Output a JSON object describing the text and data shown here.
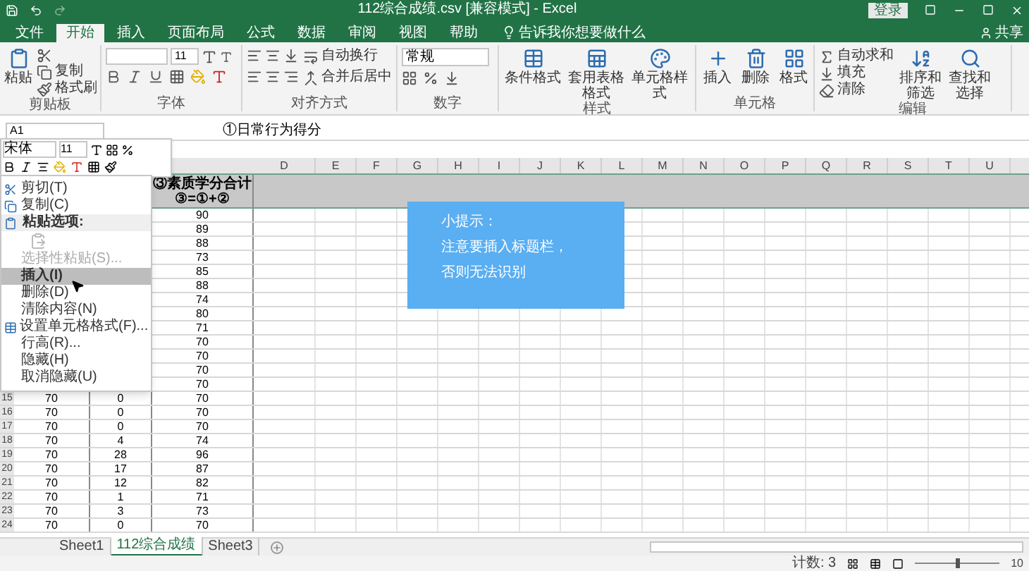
{
  "title_bar": {
    "title": "112综合成绩.csv [兼容模式] - Excel",
    "sign_in": "登录"
  },
  "tabs": [
    {
      "label": "文件",
      "selected": false
    },
    {
      "label": "开始",
      "selected": true
    },
    {
      "label": "插入",
      "selected": false
    },
    {
      "label": "页面布局",
      "selected": false
    },
    {
      "label": "公式",
      "selected": false
    },
    {
      "label": "数据",
      "selected": false
    },
    {
      "label": "审阅",
      "selected": false
    },
    {
      "label": "视图",
      "selected": false
    },
    {
      "label": "帮助",
      "selected": false
    }
  ],
  "tell_me": "告诉我你想要做什么",
  "share": "共享",
  "ribbon": {
    "clipboard": {
      "label": "剪贴板",
      "paste": "粘贴",
      "copy": "复制",
      "format_painter": "格式刷"
    },
    "font": {
      "label": "字体",
      "size": "11"
    },
    "alignment": {
      "label": "对齐方式",
      "wrap": "自动换行",
      "merge": "合并后居中"
    },
    "number": {
      "label": "数字",
      "format": "常规"
    },
    "styles": {
      "label": "样式",
      "items": [
        "条件格式",
        "套用表格格式",
        "单元格样式"
      ]
    },
    "cells": {
      "label": "单元格",
      "items": [
        "插入",
        "删除",
        "格式"
      ]
    },
    "editing": {
      "label": "编辑",
      "items": [
        "自动求和",
        "填充",
        "清除"
      ],
      "large": [
        "排序和筛选",
        "查找和选择"
      ]
    }
  },
  "name_box": "A1",
  "formula": "①日常行为得分",
  "mini_toolbar": {
    "font": "宋体",
    "size": "11"
  },
  "columns": [
    "D",
    "E",
    "F",
    "G",
    "H",
    "I",
    "J",
    "K",
    "L",
    "M",
    "N",
    "O",
    "P",
    "Q",
    "R",
    "S",
    "T",
    "U"
  ],
  "header_c": [
    "③素质学分合计",
    "③=①+②"
  ],
  "rows": [
    {
      "c": "90"
    },
    {
      "c": "89"
    },
    {
      "c": "88"
    },
    {
      "c": "73"
    },
    {
      "c": "85"
    },
    {
      "c": "88"
    },
    {
      "c": "74"
    },
    {
      "c": "80"
    },
    {
      "c": "71"
    },
    {
      "c": "70"
    },
    {
      "c": "70"
    },
    {
      "c": "70"
    },
    {
      "c": "70"
    },
    {
      "number": "15",
      "a": "70",
      "b": "0",
      "c": "70"
    },
    {
      "number": "16",
      "a": "70",
      "b": "0",
      "c": "70"
    },
    {
      "number": "17",
      "a": "70",
      "b": "0",
      "c": "70"
    },
    {
      "number": "18",
      "a": "70",
      "b": "4",
      "c": "74"
    },
    {
      "number": "19",
      "a": "70",
      "b": "28",
      "c": "96"
    },
    {
      "number": "20",
      "a": "70",
      "b": "17",
      "c": "87"
    },
    {
      "number": "21",
      "a": "70",
      "b": "12",
      "c": "82"
    },
    {
      "number": "22",
      "a": "70",
      "b": "1",
      "c": "71"
    },
    {
      "number": "23",
      "a": "70",
      "b": "3",
      "c": "73"
    },
    {
      "number": "24",
      "a": "70",
      "b": "0",
      "c": "70"
    }
  ],
  "context_menu": [
    {
      "kind": "item",
      "text": "剪切(T)",
      "disabled": false,
      "selected": false
    },
    {
      "kind": "item",
      "text": "复制(C)",
      "disabled": false,
      "selected": false
    },
    {
      "kind": "header",
      "text": "粘贴选项:"
    },
    {
      "kind": "icons"
    },
    {
      "kind": "item",
      "text": "选择性粘贴(S)...",
      "disabled": true,
      "selected": false
    },
    {
      "kind": "item",
      "text": "插入(I)",
      "disabled": false,
      "selected": true
    },
    {
      "kind": "item",
      "text": "删除(D)",
      "disabled": false,
      "selected": false
    },
    {
      "kind": "item",
      "text": "清除内容(N)",
      "disabled": false,
      "selected": false
    },
    {
      "kind": "item",
      "text": "设置单元格格式(F)...",
      "disabled": false,
      "selected": false
    },
    {
      "kind": "item",
      "text": "行高(R)...",
      "disabled": false,
      "selected": false
    },
    {
      "kind": "item",
      "text": "隐藏(H)",
      "disabled": false,
      "selected": false
    },
    {
      "kind": "item",
      "text": "取消隐藏(U)",
      "disabled": false,
      "selected": false
    }
  ],
  "tip": [
    "小提示：",
    "注意要插入标题栏，",
    "否则无法识别"
  ],
  "sheet_tabs": [
    {
      "label": "Sheet1",
      "selected": false
    },
    {
      "label": "112综合成绩",
      "selected": true
    },
    {
      "label": "Sheet3",
      "selected": false
    }
  ],
  "status": {
    "count": "计数: 3",
    "zoom": "10"
  },
  "zoom_slider": {
    "level": 0.5
  }
}
